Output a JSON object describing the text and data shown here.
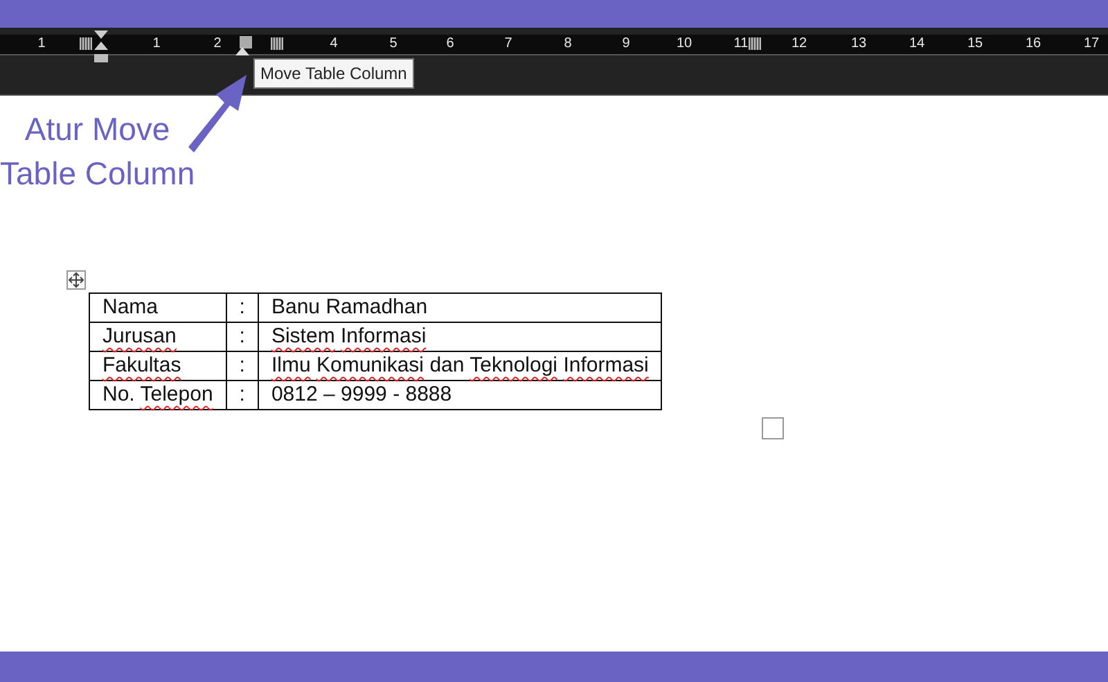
{
  "ruler": {
    "items": [
      {
        "kind": "number",
        "text": "1"
      },
      {
        "kind": "grid"
      },
      {
        "kind": "indent"
      },
      {
        "kind": "number",
        "text": "1"
      },
      {
        "kind": "number",
        "text": "2"
      },
      {
        "kind": "column"
      },
      {
        "kind": "grid"
      },
      {
        "kind": "number",
        "text": "4"
      },
      {
        "kind": "number",
        "text": "5"
      },
      {
        "kind": "number",
        "text": "6"
      },
      {
        "kind": "number",
        "text": "7"
      },
      {
        "kind": "number",
        "text": "8"
      },
      {
        "kind": "number",
        "text": "9"
      },
      {
        "kind": "number",
        "text": "10"
      },
      {
        "kind": "number",
        "text": "11"
      },
      {
        "kind": "grid"
      },
      {
        "kind": "number",
        "text": "12"
      },
      {
        "kind": "number",
        "text": "13"
      },
      {
        "kind": "number",
        "text": "14"
      },
      {
        "kind": "number",
        "text": "15"
      },
      {
        "kind": "number",
        "text": "16"
      },
      {
        "kind": "number",
        "text": "17"
      }
    ]
  },
  "tooltip": "Move Table Column",
  "annotation": [
    "Atur Move",
    "Table Column"
  ],
  "table": {
    "rows": [
      [
        [
          {
            "text": "Nama",
            "misspelled": false
          }
        ],
        ":",
        [
          {
            "text": "Banu",
            "misspelled": false
          },
          {
            "text": "Ramadhan",
            "misspelled": false
          }
        ]
      ],
      [
        [
          {
            "text": "Jurusan",
            "misspelled": true
          }
        ],
        ":",
        [
          {
            "text": "Sistem",
            "misspelled": true
          },
          {
            "text": "Informasi",
            "misspelled": true
          }
        ]
      ],
      [
        [
          {
            "text": "Fakultas",
            "misspelled": true
          }
        ],
        ":",
        [
          {
            "text": "Ilmu",
            "misspelled": true
          },
          {
            "text": "Komunikasi",
            "misspelled": true
          },
          {
            "text": "dan",
            "misspelled": false
          },
          {
            "text": "Teknologi",
            "misspelled": true
          },
          {
            "text": "Informasi",
            "misspelled": true
          }
        ]
      ],
      [
        [
          {
            "text": "No.",
            "misspelled": false
          },
          {
            "text": "Telepon",
            "misspelled": true
          }
        ],
        ":",
        [
          {
            "text": "0812",
            "misspelled": false
          },
          {
            "text": "–",
            "misspelled": false
          },
          {
            "text": "9999",
            "misspelled": false
          },
          {
            "text": "-",
            "misspelled": false
          },
          {
            "text": "8888",
            "misspelled": false
          }
        ]
      ]
    ]
  }
}
